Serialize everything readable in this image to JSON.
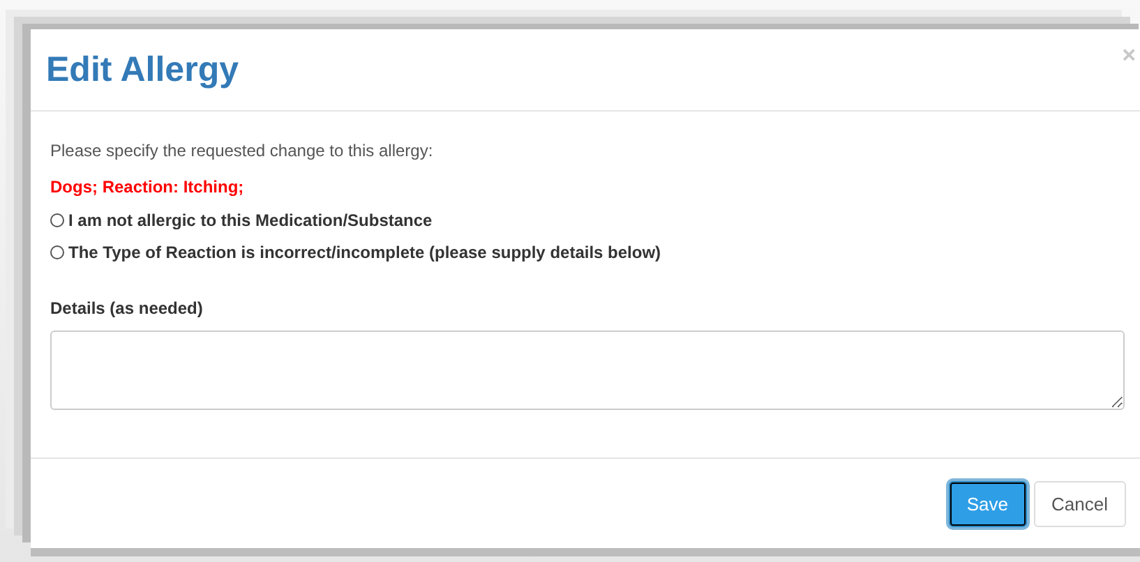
{
  "dialog": {
    "title": "Edit Allergy",
    "close": "×",
    "prompt": "Please specify the requested change to this allergy:",
    "allergy": "Dogs; Reaction: Itching;",
    "options": [
      {
        "label": "I am not allergic to this Medication/Substance",
        "selected": false
      },
      {
        "label": "The Type of Reaction is incorrect/incomplete (please supply details below)",
        "selected": false
      }
    ],
    "details_label": "Details (as needed)",
    "buttons": [
      {
        "label": "Save",
        "kind": "primary",
        "focused": true
      },
      {
        "label": "Cancel",
        "kind": "default",
        "focused": false
      }
    ]
  }
}
